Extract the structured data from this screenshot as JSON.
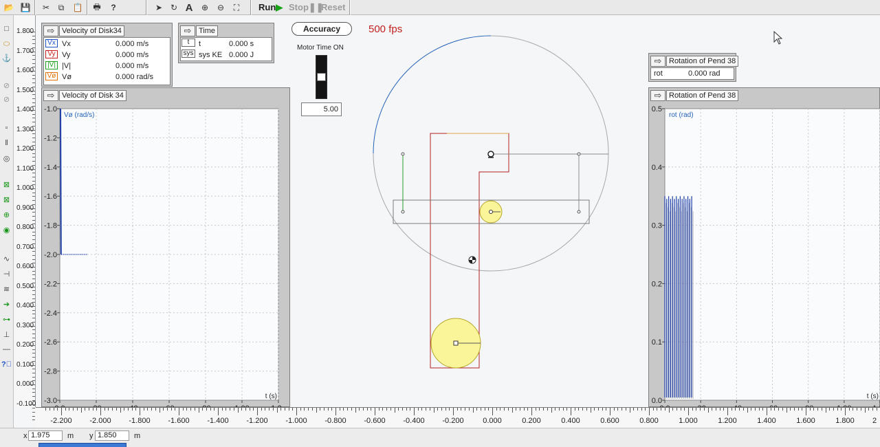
{
  "toolbar": {
    "run_label": "Run",
    "stop_label": "Stop",
    "reset_label": "Reset"
  },
  "accuracy_label": "Accuracy",
  "fps_label": "500 fps",
  "motor": {
    "label": "Motor Time ON",
    "value": "5.00"
  },
  "meter_velocity_digital": {
    "title": "Velocity of Disk34",
    "rows": [
      {
        "chip": "Vx",
        "label": "Vx",
        "value": "0.000 m/s",
        "color": "#1e50c8"
      },
      {
        "chip": "Vy",
        "label": "Vy",
        "value": "0.000 m/s",
        "color": "#c81e1e"
      },
      {
        "chip": "|V|",
        "label": "|V|",
        "value": "0.000 m/s",
        "color": "#1ea01e"
      },
      {
        "chip": "Vø",
        "label": "Vø",
        "value": "0.000 rad/s",
        "color": "#e07000"
      }
    ]
  },
  "meter_time": {
    "title": "Time",
    "rows": [
      {
        "chip": "t",
        "label": "t",
        "value": "0.000 s"
      },
      {
        "chip": "sys",
        "label": "sys KE",
        "value": "0.000 J"
      }
    ]
  },
  "meter_rotation_digital": {
    "title": "Rotation of Pend 38",
    "row": {
      "label": "rot",
      "value": "0.000 rad"
    }
  },
  "graph_velocity": {
    "title": "Velocity of Disk 34",
    "y_label": "Vø (rad/s)",
    "x_label": "t (s)",
    "y_ticks": [
      "-1.0",
      "-1.2",
      "-1.4",
      "-1.6",
      "-1.8",
      "-2.0",
      "-2.2",
      "-2.4",
      "-2.6",
      "-2.8",
      "-3.0"
    ],
    "x_ticks": [
      "0.0",
      ".20",
      ".40",
      ".60",
      ".80",
      "1.00",
      "1.20"
    ]
  },
  "graph_rotation": {
    "title": "Rotation of Pend 38",
    "y_label": "rot (rad)",
    "x_label": "t (s)",
    "y_ticks": [
      "0.5",
      "0.4",
      "0.3",
      "0.2",
      "0.1",
      "0.0"
    ],
    "x_ticks": [
      "0.0",
      ".20",
      ".40",
      ".60",
      ".80",
      "1.00",
      "1.20"
    ]
  },
  "chart_data": [
    {
      "type": "line",
      "title": "Velocity of Disk 34",
      "ylabel": "Vø (rad/s)",
      "xlabel": "t (s)",
      "ylim": [
        -3.0,
        -1.0
      ],
      "xlim": [
        0.0,
        1.2
      ],
      "grid": true,
      "series": [
        {
          "name": "Vø",
          "x": [
            0.0,
            0.003,
            0.006,
            0.15
          ],
          "y": [
            -1.0,
            -2.0,
            -2.0,
            -2.0
          ]
        }
      ]
    },
    {
      "type": "line",
      "title": "Rotation of Pend 38",
      "ylabel": "rot (rad)",
      "xlabel": "t (s)",
      "ylim": [
        0.0,
        0.5
      ],
      "xlim": [
        0.0,
        1.2
      ],
      "grid": true,
      "series": [
        {
          "name": "rot",
          "x": [
            0.0,
            0.15
          ],
          "y": [
            0.35,
            0.0
          ]
        }
      ]
    }
  ],
  "vruler": {
    "labels": [
      "1.800",
      "1.700",
      "1.600",
      "1.500",
      "1.400",
      "1.300",
      "1.200",
      "1.100",
      "1.000",
      "0.900",
      "0.800",
      "0.700",
      "0.600",
      "0.500",
      "0.400",
      "0.300",
      "0.200",
      "0.100",
      "0.000",
      "-0.100"
    ]
  },
  "hruler": {
    "labels": [
      "-2.200",
      "-2.000",
      "-1.800",
      "-1.600",
      "-1.400",
      "-1.200",
      "-1.000",
      "-0.800",
      "-0.600",
      "-0.400",
      "-0.200",
      "0.000",
      "0.200",
      "0.400",
      "0.600",
      "0.800",
      "1.000",
      "1.200",
      "1.400",
      "1.600",
      "1.800",
      "2"
    ]
  },
  "status": {
    "x_label": "x",
    "x_value": "1.975",
    "x_unit": "m",
    "y_label": "y",
    "y_value": "1.850",
    "y_unit": "m"
  }
}
